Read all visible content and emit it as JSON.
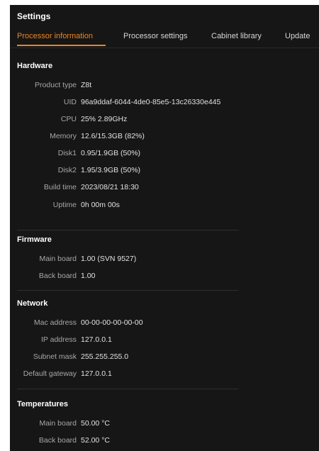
{
  "window": {
    "title": "Settings"
  },
  "tabs": [
    {
      "label": "Processor information",
      "active": true
    },
    {
      "label": "Processor settings",
      "active": false
    },
    {
      "label": "Cabinet library",
      "active": false
    },
    {
      "label": "Update",
      "active": false
    }
  ],
  "hardware": {
    "title": "Hardware",
    "rows": [
      {
        "label": "Product type",
        "value": "Z8t"
      },
      {
        "label": "UID",
        "value": "96a9ddaf-6044-4de0-85e5-13c26330e445"
      },
      {
        "label": "CPU",
        "value": "25% 2.89GHz"
      },
      {
        "label": "Memory",
        "value": "12.6/15.3GB (82%)"
      },
      {
        "label": "Disk1",
        "value": "0.95/1.9GB (50%)"
      },
      {
        "label": "Disk2",
        "value": "1.95/3.9GB (50%)"
      },
      {
        "label": "Build time",
        "value": "2023/08/21 18:30"
      },
      {
        "label": "Uptime",
        "value": "0h 00m 00s"
      }
    ]
  },
  "firmware": {
    "title": "Firmware",
    "rows": [
      {
        "label": "Main board",
        "value": "1.00 (SVN 9527)"
      },
      {
        "label": "Back board",
        "value": "1.00"
      }
    ]
  },
  "network": {
    "title": "Network",
    "rows": [
      {
        "label": "Mac address",
        "value": "00-00-00-00-00-00"
      },
      {
        "label": "IP address",
        "value": "127.0.0.1"
      },
      {
        "label": "Subnet mask",
        "value": "255.255.255.0"
      },
      {
        "label": "Default gateway",
        "value": "127.0.0.1"
      }
    ]
  },
  "temperatures": {
    "title": "Temperatures",
    "rows": [
      {
        "label": "Main board",
        "value": "50.00 °C"
      },
      {
        "label": "Back board",
        "value": "52.00 °C"
      }
    ]
  },
  "colors": {
    "accent": "#f0851f",
    "background": "#161616"
  }
}
